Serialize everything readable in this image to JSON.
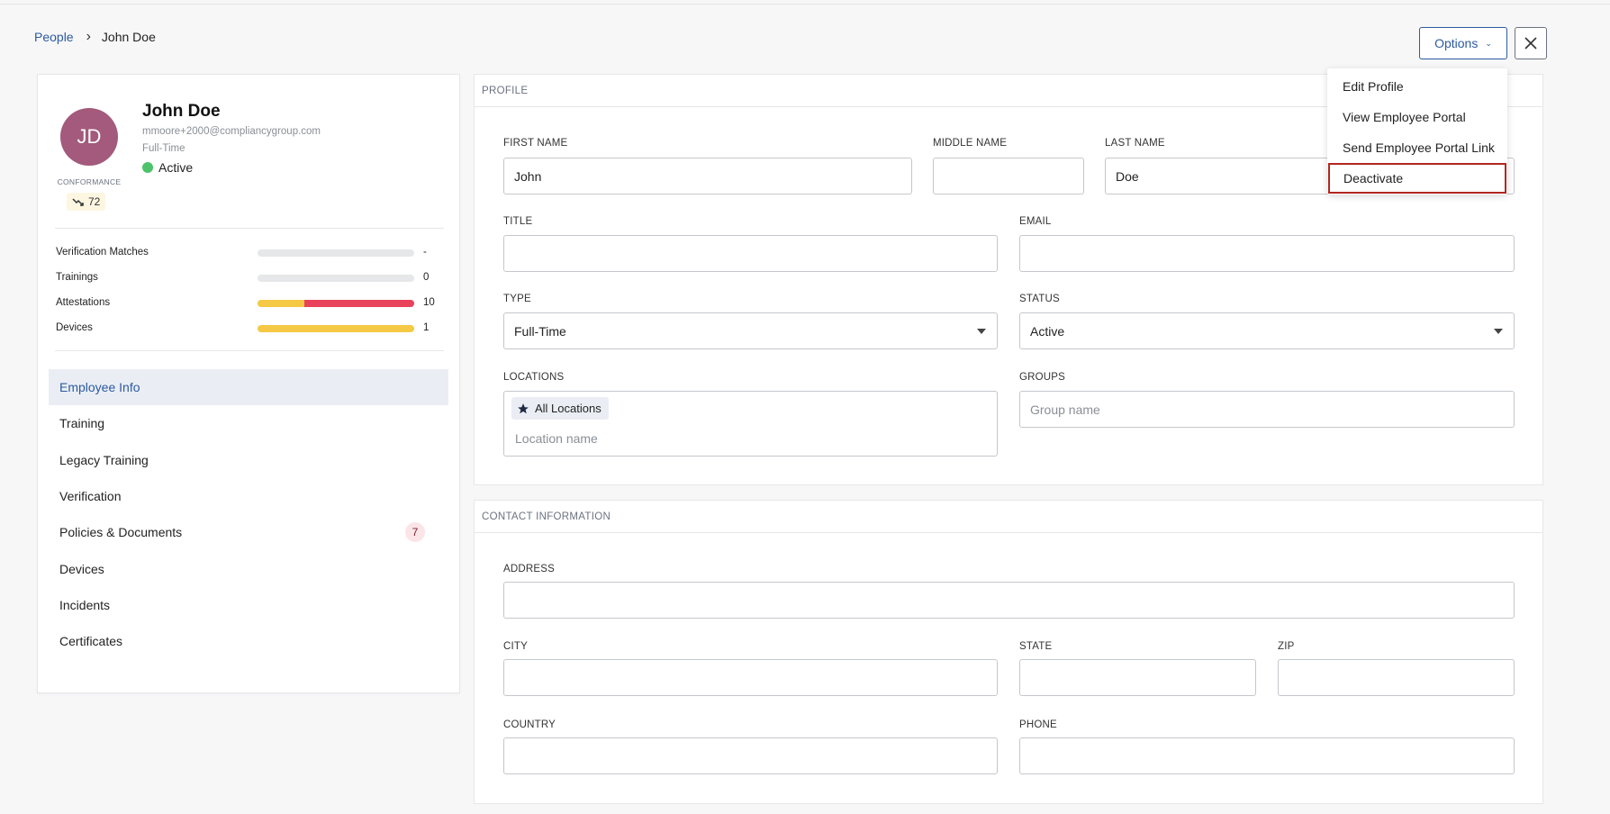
{
  "breadcrumb": {
    "parent": "People",
    "current": "John Doe"
  },
  "header": {
    "options_label": "Options"
  },
  "employee": {
    "initials": "JD",
    "name": "John Doe",
    "email": "mmoore+2000@compliancygroup.com",
    "type": "Full-Time",
    "status": "Active",
    "conformance_label": "CONFORMANCE",
    "conformance_score": "72"
  },
  "stats": [
    {
      "label": "Verification Matches",
      "value": "-",
      "segments": []
    },
    {
      "label": "Trainings",
      "value": "0",
      "segments": []
    },
    {
      "label": "Attestations",
      "value": "10",
      "segments": [
        {
          "fraction": 0.3,
          "color": "#f5c945"
        },
        {
          "fraction": 0.7,
          "color": "#e8435a"
        }
      ]
    },
    {
      "label": "Devices",
      "value": "1",
      "segments": [
        {
          "fraction": 1.0,
          "color": "#f5c945"
        }
      ]
    }
  ],
  "nav": {
    "items": [
      {
        "label": "Employee Info",
        "active": true
      },
      {
        "label": "Training"
      },
      {
        "label": "Legacy Training"
      },
      {
        "label": "Verification"
      },
      {
        "label": "Policies & Documents",
        "badge": "7"
      },
      {
        "label": "Devices"
      },
      {
        "label": "Incidents"
      },
      {
        "label": "Certificates"
      }
    ]
  },
  "profile": {
    "heading": "PROFILE",
    "first_name_label": "FIRST NAME",
    "first_name": "John",
    "middle_name_label": "MIDDLE NAME",
    "middle_name": "",
    "last_name_label": "LAST NAME",
    "last_name": "Doe",
    "title_label": "TITLE",
    "title": "",
    "email_label": "EMAIL",
    "email": "",
    "type_label": "TYPE",
    "type": "Full-Time",
    "status_label": "STATUS",
    "status": "Active",
    "locations_label": "LOCATIONS",
    "location_tag": "All Locations",
    "location_placeholder": "Location name",
    "groups_label": "GROUPS",
    "groups_placeholder": "Group name"
  },
  "contact": {
    "heading": "CONTACT INFORMATION",
    "address_label": "ADDRESS",
    "city_label": "CITY",
    "state_label": "STATE",
    "zip_label": "ZIP",
    "country_label": "COUNTRY",
    "phone_label": "PHONE"
  },
  "options_menu": {
    "items": [
      {
        "label": "Edit Profile"
      },
      {
        "label": "View Employee Portal"
      },
      {
        "label": "Send Employee Portal Link"
      },
      {
        "label": "Deactivate",
        "highlighted": true
      }
    ]
  }
}
